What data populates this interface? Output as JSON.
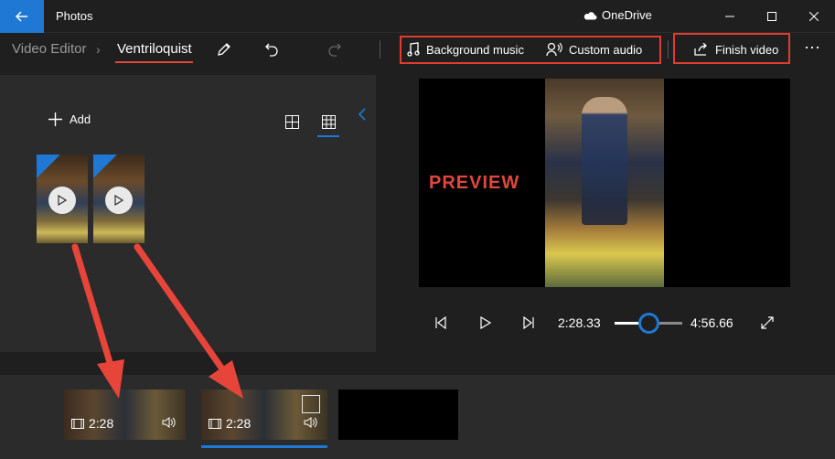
{
  "titlebar": {
    "app_title": "Photos",
    "cloud_label": "OneDrive",
    "icons": {
      "back": "back-arrow-icon",
      "cloud": "cloud-icon",
      "minimize": "minimize-icon",
      "maximize": "maximize-icon",
      "close": "close-icon"
    }
  },
  "toolbar": {
    "breadcrumb_root": "Video Editor",
    "breadcrumb_sep": "›",
    "project_name": "Ventriloquist",
    "background_music_label": "Background music",
    "custom_audio_label": "Custom audio",
    "finish_video_label": "Finish video",
    "more_label": "⋯",
    "icons": [
      "pencil-icon",
      "undo-icon",
      "redo-icon",
      "music-note-icon",
      "custom-audio-icon",
      "share-export-icon",
      "more-icon"
    ]
  },
  "library": {
    "add_label": "Add",
    "thumbnails": [
      {
        "kind": "video",
        "selected_corner": true
      },
      {
        "kind": "video",
        "selected_corner": true
      }
    ]
  },
  "preview": {
    "overlay_text": "PREVIEW",
    "current_time": "2:28.33",
    "total_time": "4:56.66",
    "progress": 0.5
  },
  "storyboard": {
    "cards": [
      {
        "duration": "2:28",
        "selected": false
      },
      {
        "duration": "2:28",
        "selected": true
      },
      {
        "duration": "",
        "empty": true
      }
    ]
  },
  "colors": {
    "accent": "#1e78d4",
    "highlight": "#e03c31",
    "annotation_arrow": "#e8453a",
    "background": "#1f1f1f",
    "panel": "#2b2b2b"
  }
}
